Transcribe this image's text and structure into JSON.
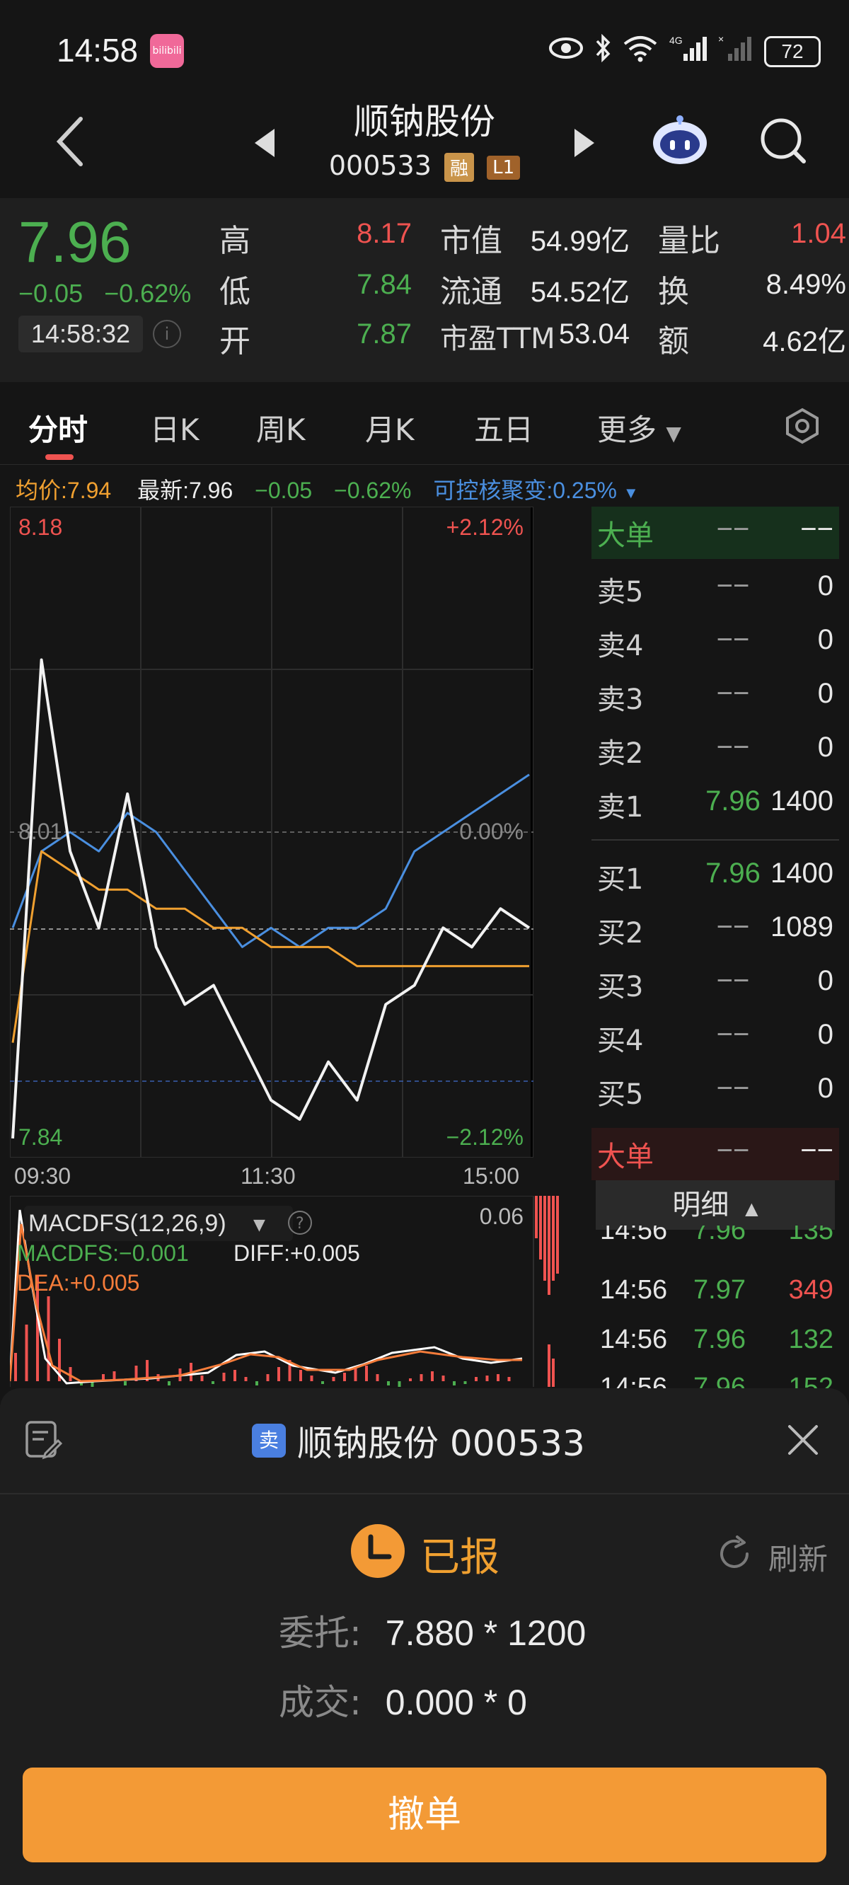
{
  "status_bar": {
    "time": "14:58",
    "bili_label": "bilibili",
    "battery": "72"
  },
  "header": {
    "stock_name": "顺钠股份",
    "stock_code": "000533",
    "tag_rong": "融",
    "tag_l1": "L1"
  },
  "quote": {
    "price": "7.96",
    "change": "−0.05",
    "change_pct": "−0.62%",
    "time": "14:58:32",
    "high_label": "高",
    "high": "8.17",
    "low_label": "低",
    "low": "7.84",
    "open_label": "开",
    "open": "7.87",
    "mktcap_label": "市值",
    "mktcap": "54.99亿",
    "float_label": "流通",
    "float": "54.52亿",
    "pe_label": "市盈TTM",
    "pe": "53.04",
    "vol_ratio_label": "量比",
    "vol_ratio": "1.04",
    "turnover_label": "换",
    "turnover": "8.49%",
    "amount_label": "额",
    "amount": "4.62亿"
  },
  "tabs": [
    "分时",
    "日K",
    "周K",
    "月K",
    "五日",
    "更多"
  ],
  "info_line": {
    "avg": "均价:7.94",
    "latest": "最新:7.96",
    "change": "−0.05",
    "change_pct": "−0.62%",
    "convertible": "可控核聚变:0.25%"
  },
  "chart": {
    "top_price": "8.18",
    "top_pct": "+2.12%",
    "mid_price": "8.01",
    "mid_pct": "0.00%",
    "bottom_price": "7.84",
    "bottom_pct": "−2.12%",
    "time_start": "09:30",
    "time_mid": "11:30",
    "time_end": "15:00",
    "macd_title": "MACDFS(12,26,9)",
    "macd_max": "0.06",
    "macd_value": "MACDFS:−0.001",
    "diff_value": "DIFF:+0.005",
    "dea_value": "DEA:+0.005"
  },
  "chart_data": {
    "type": "line",
    "ylim": [
      7.84,
      8.18
    ],
    "series": [
      {
        "values": [
          7.85,
          8.1,
          8.0,
          7.96,
          8.03,
          7.95,
          7.92,
          7.93,
          7.9,
          7.87,
          7.86,
          7.89,
          7.87,
          7.92,
          7.93,
          7.96,
          7.95,
          7.97,
          7.96
        ]
      },
      {
        "values": [
          7.9,
          8.0,
          7.99,
          7.98,
          7.98,
          7.97,
          7.97,
          7.96,
          7.96,
          7.95,
          7.95,
          7.95,
          7.94,
          7.94,
          7.94,
          7.94,
          7.94,
          7.94,
          7.94
        ]
      },
      {
        "values": [
          7.96,
          8.0,
          8.01,
          8.0,
          8.02,
          8.01,
          7.99,
          7.97,
          7.95,
          7.96,
          7.95,
          7.96,
          7.96,
          7.97,
          8.0,
          8.01,
          8.02,
          8.03,
          8.04
        ]
      }
    ]
  },
  "orderbook": {
    "big_sell": {
      "label": "大单",
      "price": "−−",
      "vol": "−−"
    },
    "asks": [
      {
        "label": "卖5",
        "price": "−−",
        "vol": "0"
      },
      {
        "label": "卖4",
        "price": "−−",
        "vol": "0"
      },
      {
        "label": "卖3",
        "price": "−−",
        "vol": "0"
      },
      {
        "label": "卖2",
        "price": "−−",
        "vol": "0"
      },
      {
        "label": "卖1",
        "price": "7.96",
        "vol": "1400"
      }
    ],
    "bids": [
      {
        "label": "买1",
        "price": "7.96",
        "vol": "1400"
      },
      {
        "label": "买2",
        "price": "−−",
        "vol": "1089"
      },
      {
        "label": "买3",
        "price": "−−",
        "vol": "0"
      },
      {
        "label": "买4",
        "price": "−−",
        "vol": "0"
      },
      {
        "label": "买5",
        "price": "−−",
        "vol": "0"
      }
    ],
    "big_buy": {
      "label": "大单",
      "price": "−−",
      "vol": "−−"
    }
  },
  "detail": {
    "header": "明细",
    "ticks": [
      {
        "time": "14:56",
        "price": "7.96",
        "vol": "135"
      },
      {
        "time": "14:56",
        "price": "7.97",
        "vol": "349"
      },
      {
        "time": "14:56",
        "price": "7.96",
        "vol": "132"
      },
      {
        "time": "14:56",
        "price": "7.96",
        "vol": "152"
      }
    ]
  },
  "order_sheet": {
    "side_badge": "卖",
    "title": "顺钠股份 000533",
    "status": "已报",
    "refresh": "刷新",
    "entrust_label": "委托:",
    "entrust_value": "7.880 * 1200",
    "deal_label": "成交:",
    "deal_value": "0.000 * 0",
    "cancel_button": "撤单"
  },
  "colors": {
    "up": "#ef5350",
    "down": "#4caf50",
    "accent": "#f39a36",
    "avg_line": "#f0a030",
    "index_line": "#4a8fe0"
  }
}
